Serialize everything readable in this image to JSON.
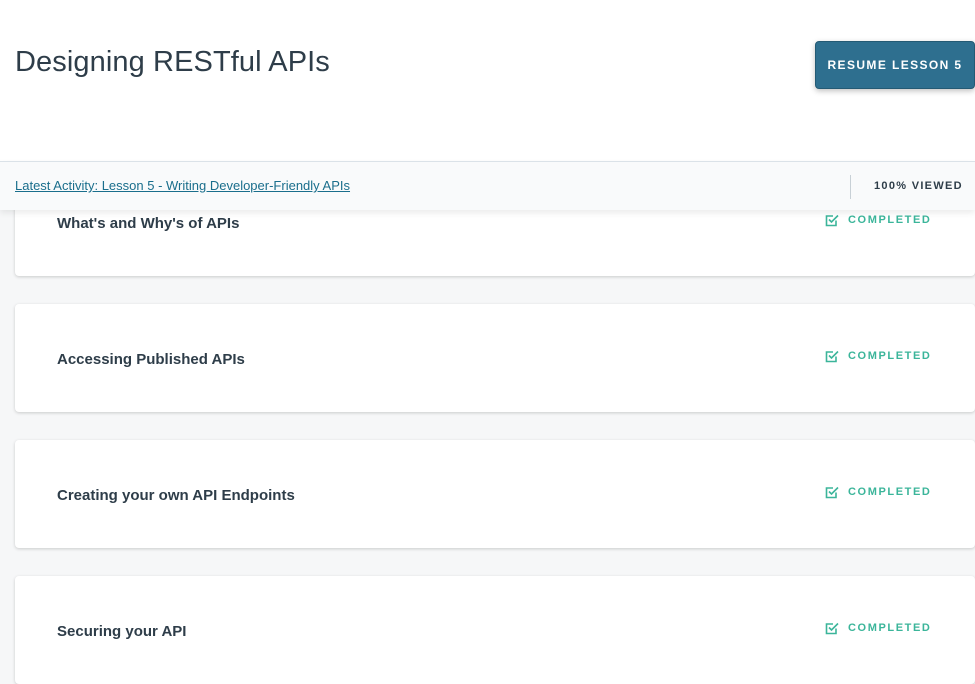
{
  "header": {
    "title": "Designing RESTful APIs",
    "resume_label": "RESUME LESSON 5"
  },
  "activity": {
    "link_text": "Latest Activity: Lesson 5 - Writing Developer-Friendly APIs",
    "viewed_text": "100% VIEWED"
  },
  "colors": {
    "accent": "#2e6f8f",
    "completed": "#3bb59a"
  },
  "lessons": [
    {
      "title": "What's and Why's of APIs",
      "status": "COMPLETED",
      "icon": "checkbox-checked-icon"
    },
    {
      "title": "Accessing Published APIs",
      "status": "COMPLETED",
      "icon": "checkbox-checked-icon"
    },
    {
      "title": "Creating your own API Endpoints",
      "status": "COMPLETED",
      "icon": "checkbox-checked-icon"
    },
    {
      "title": "Securing your API",
      "status": "COMPLETED",
      "icon": "checkbox-checked-icon"
    }
  ]
}
